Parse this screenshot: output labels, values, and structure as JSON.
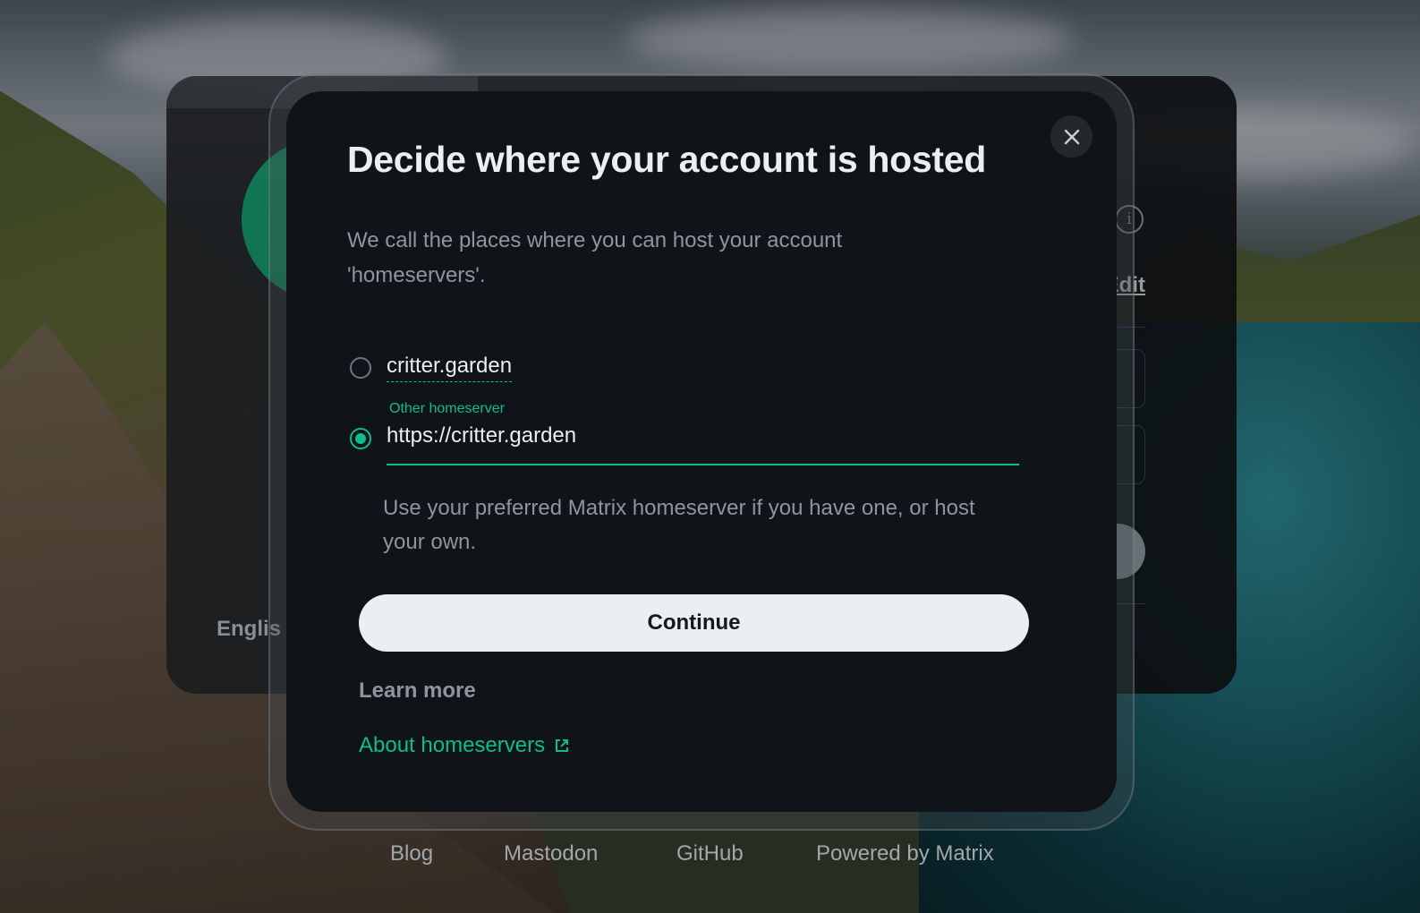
{
  "dialog": {
    "title": "Decide where your account is hosted",
    "description": "We call the places where you can host your account 'homeservers'.",
    "options": [
      {
        "label": "critter.garden",
        "selected": false
      },
      {
        "field_label": "Other homeserver",
        "value": "https://critter.garden",
        "selected": true
      }
    ],
    "hint": "Use your preferred Matrix homeserver if you have one, or host your own.",
    "continue_label": "Continue",
    "learn_more_heading": "Learn more",
    "about_link": "About homeservers",
    "close_icon": "close-icon",
    "external_link_icon": "external-link-icon"
  },
  "background_card": {
    "language_partial": "Englis",
    "edit_partial": "Edit",
    "info_icon": "info-icon"
  },
  "footer": {
    "links": [
      "Blog",
      "Mastodon",
      "GitHub",
      "Powered by Matrix"
    ]
  },
  "colors": {
    "accent": "#0dbd8b",
    "dialog_bg": "#101317",
    "button_bg": "#ebeef2",
    "muted_text": "#8d959d"
  }
}
